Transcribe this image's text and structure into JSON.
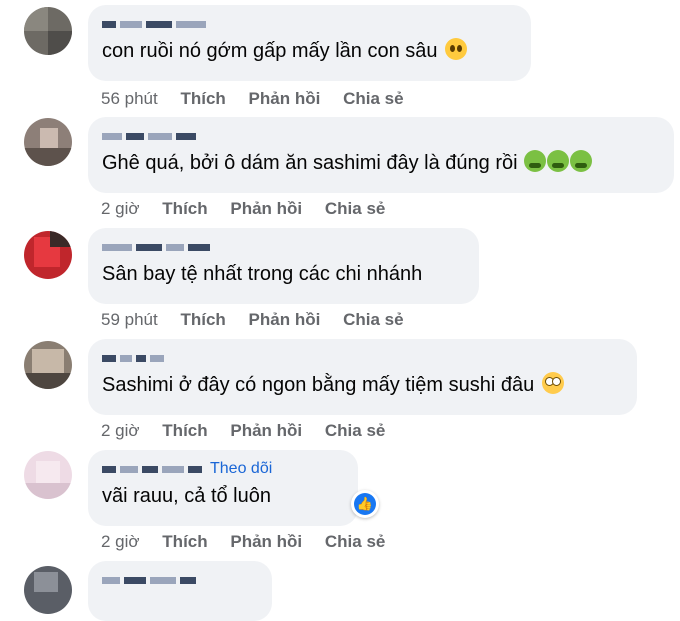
{
  "comments": [
    {
      "text": "con ruồi nó gớm gấp mấy lần con sâu",
      "emoji": [
        "cry-icon"
      ],
      "time": "56 phút",
      "like": "Thích",
      "reply": "Phản hồi",
      "share": "Chia sẻ"
    },
    {
      "text": "Ghê quá, bởi ô dám ăn sashimi đây là đúng rồi",
      "emoji": [
        "nauseated-icon",
        "nauseated-icon",
        "nauseated-icon"
      ],
      "time": "2 giờ",
      "like": "Thích",
      "reply": "Phản hồi",
      "share": "Chia sẻ"
    },
    {
      "text": "Sân bay tệ nhất trong các chi nhánh",
      "emoji": [],
      "time": "59 phút",
      "like": "Thích",
      "reply": "Phản hồi",
      "share": "Chia sẻ"
    },
    {
      "text": "Sashimi ở đây có ngon bằng mấy tiệm sushi đâu",
      "emoji": [
        "eye-roll-icon"
      ],
      "time": "2 giờ",
      "like": "Thích",
      "reply": "Phản hồi",
      "share": "Chia sẻ"
    },
    {
      "text": "vãi rauu, cả tổ luôn",
      "emoji": [],
      "follow": "Theo dõi",
      "reaction": "like-reaction-icon",
      "time": "2 giờ",
      "like": "Thích",
      "reply": "Phản hồi",
      "share": "Chia sẻ"
    },
    {
      "text": "",
      "emoji": []
    }
  ],
  "colors": {
    "bubble": "#f0f2f5",
    "meta": "#65676b",
    "link": "#1a66d6",
    "like_blue": "#1877f2"
  }
}
